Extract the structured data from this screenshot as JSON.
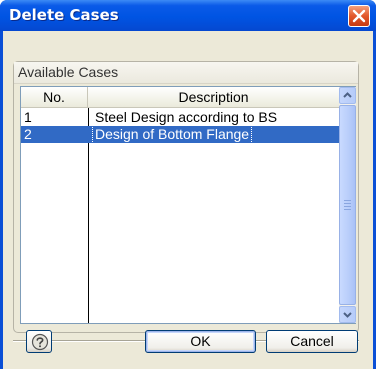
{
  "window": {
    "title": "Delete Cases"
  },
  "group": {
    "title": "Available Cases"
  },
  "table": {
    "columns": [
      "No.",
      "Description"
    ],
    "rows": [
      {
        "no": "1",
        "description": "Steel Design according to BS",
        "selected": false
      },
      {
        "no": "2",
        "description": "Design of Bottom Flange",
        "selected": true
      }
    ]
  },
  "buttons": {
    "ok": "OK",
    "cancel": "Cancel",
    "help_icon": "help-icon"
  },
  "colors": {
    "titlebar": "#0054e3",
    "selection": "#316ac5",
    "dialog_bg": "#ece9d8"
  }
}
